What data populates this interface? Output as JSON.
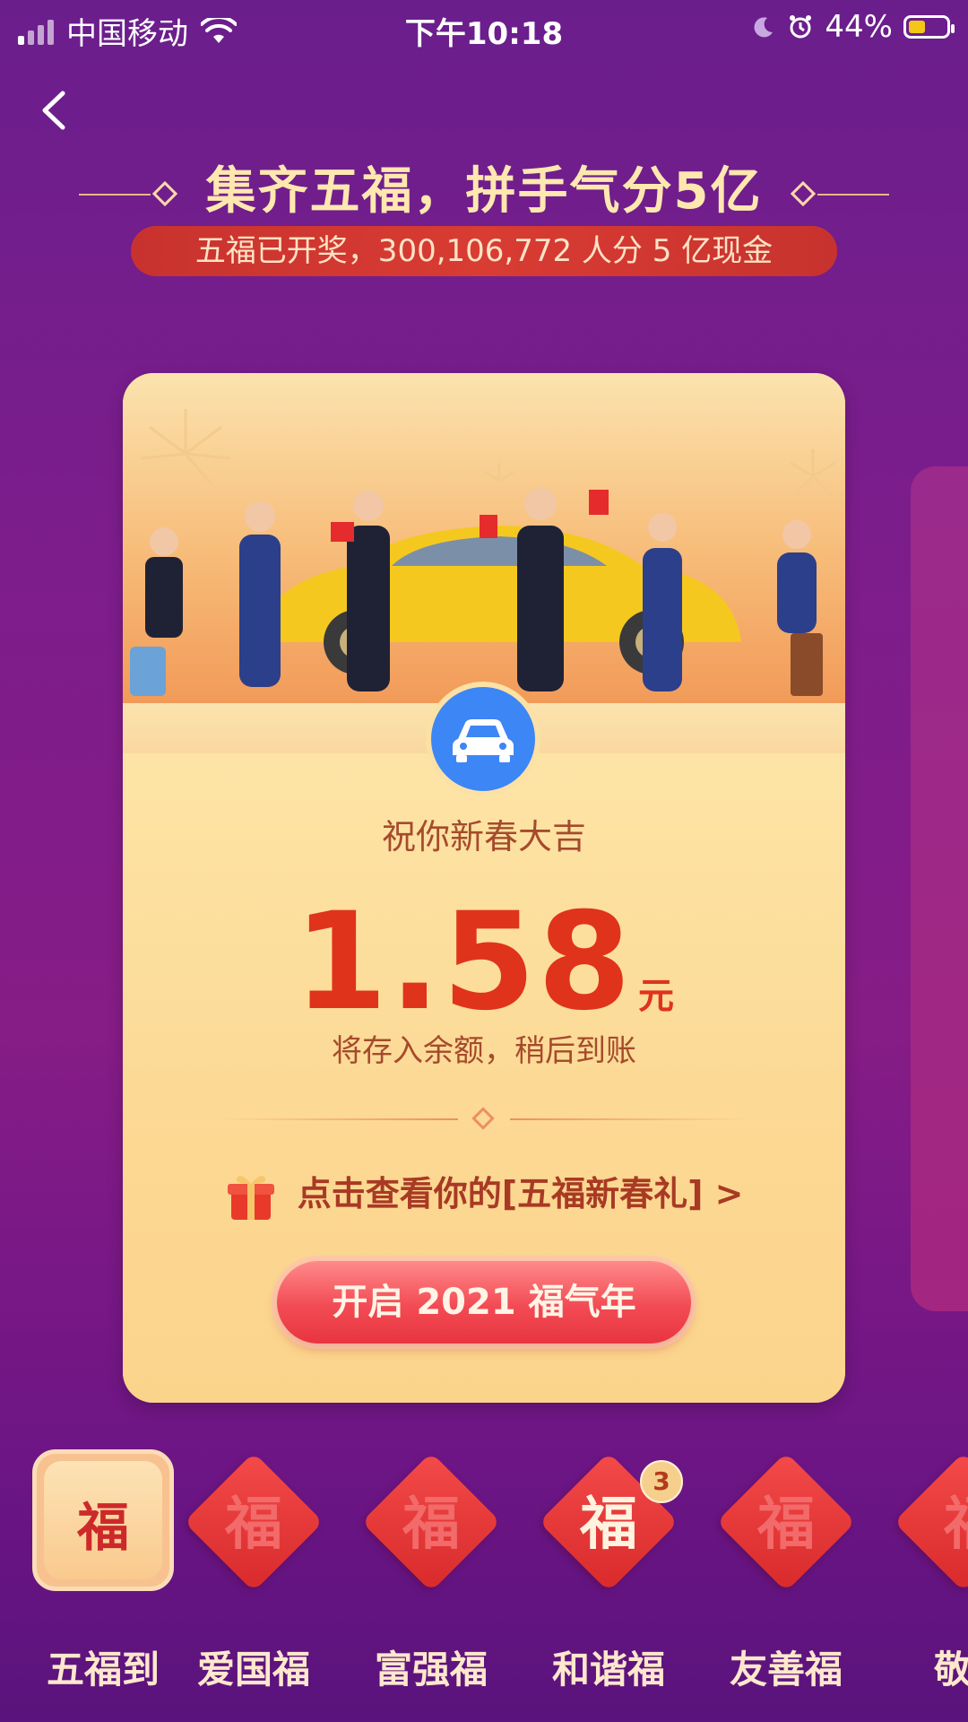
{
  "status_bar": {
    "carrier": "中国移动",
    "time": "下午10:18",
    "battery_percent": "44%",
    "battery_level": 0.44
  },
  "header": {
    "title": "集齐五福，拼手气分5亿",
    "subtitle": "五福已开奖，300,106,772 人分 5 亿现金"
  },
  "card": {
    "greeting": "祝你新春大吉",
    "amount": "1.58",
    "unit": "元",
    "notice": "将存入余额，稍后到账",
    "gift_link": "点击查看你的[五福新春礼] >",
    "button": "开启 2021 福气年",
    "icon": "car-icon"
  },
  "tabs": [
    {
      "label": "五福到",
      "char": "福",
      "active": true
    },
    {
      "label": "爱国福",
      "char": "福"
    },
    {
      "label": "富强福",
      "char": "福"
    },
    {
      "label": "和谐福",
      "char": "福",
      "badge": "3"
    },
    {
      "label": "友善福",
      "char": "福"
    },
    {
      "label": "敬",
      "char": "福"
    }
  ],
  "colors": {
    "background": "#7c1d8c",
    "card": "#fdd996",
    "amount": "#e0331c",
    "button": "#f24b55",
    "car_icon_bg": "#3d86f5"
  }
}
